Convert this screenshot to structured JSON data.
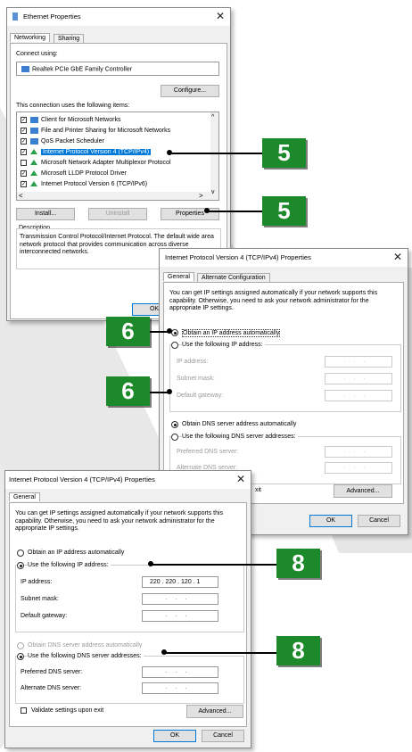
{
  "colors": {
    "badge": "#1c8a2a",
    "selection": "#0078d7"
  },
  "eth": {
    "title": "Ethernet Properties",
    "tabs": [
      "Networking",
      "Sharing"
    ],
    "connect_using_label": "Connect using:",
    "adapter": "Realtek PCIe GbE Family Controller",
    "configure": "Configure...",
    "items_label": "This connection uses the following items:",
    "items": [
      {
        "label": "Client for Microsoft Networks",
        "checked": true,
        "icon": "network-client-icon"
      },
      {
        "label": "File and Printer Sharing for Microsoft Networks",
        "checked": true,
        "icon": "network-client-icon"
      },
      {
        "label": "QoS Packet Scheduler",
        "checked": true,
        "icon": "network-client-icon"
      },
      {
        "label": "Internet Protocol Version 4 (TCP/IPv4)",
        "checked": true,
        "icon": "protocol-icon",
        "selected": true
      },
      {
        "label": "Microsoft Network Adapter Multiplexor Protocol",
        "checked": false,
        "icon": "protocol-icon"
      },
      {
        "label": "Microsoft LLDP Protocol Driver",
        "checked": true,
        "icon": "protocol-icon"
      },
      {
        "label": "Internet Protocol Version 6 (TCP/IPv6)",
        "checked": true,
        "icon": "protocol-icon"
      }
    ],
    "install": "Install...",
    "uninstall": "Uninstall",
    "properties": "Properties",
    "description_label": "Description",
    "description": "Transmission Control Protocol/Internet Protocol. The default wide area network protocol that provides communication across diverse interconnected networks.",
    "ok": "OK"
  },
  "ipv4a": {
    "title": "Internet Protocol Version 4 (TCP/IPv4) Properties",
    "tabs": [
      "General",
      "Alternate Configuration"
    ],
    "info": "You can get IP settings assigned automatically if your network supports this capability. Otherwise, you need to ask your network administrator for the appropriate IP settings.",
    "obtain_ip": "Obtain an IP address automatically",
    "use_ip": "Use the following IP address:",
    "ip_label": "IP address:",
    "subnet_label": "Subnet mask:",
    "gateway_label": "Default gateway:",
    "obtain_dns": "Obtain DNS server address automatically",
    "use_dns": "Use the following DNS server addresses:",
    "pref_dns": "Preferred DNS server:",
    "alt_dns": "Alternate DNS server:",
    "exit_fragment": "xit",
    "advanced": "Advanced...",
    "ok": "OK",
    "cancel": "Cancel"
  },
  "ipv4b": {
    "title": "Internet Protocol Version 4 (TCP/IPv4) Properties",
    "tab": "General",
    "info": "You can get IP settings assigned automatically if your network supports this capability. Otherwise, you need to ask your network administrator for the appropriate IP settings.",
    "obtain_ip": "Obtain an IP address automatically",
    "use_ip": "Use the following IP address:",
    "ip_label": "IP address:",
    "ip_value": "220 . 220 . 120 .  1",
    "subnet_label": "Subnet mask:",
    "gateway_label": "Default gateway:",
    "obtain_dns": "Obtain DNS server address automatically",
    "use_dns": "Use the following DNS server addresses:",
    "pref_dns": "Preferred DNS server:",
    "alt_dns": "Alternate DNS server:",
    "validate": "Validate settings upon exit",
    "advanced": "Advanced...",
    "ok": "OK",
    "cancel": "Cancel"
  },
  "badges": {
    "b5a": "5",
    "b5b": "5",
    "b6a": "6",
    "b6b": "6",
    "b8a": "8",
    "b8b": "8"
  }
}
